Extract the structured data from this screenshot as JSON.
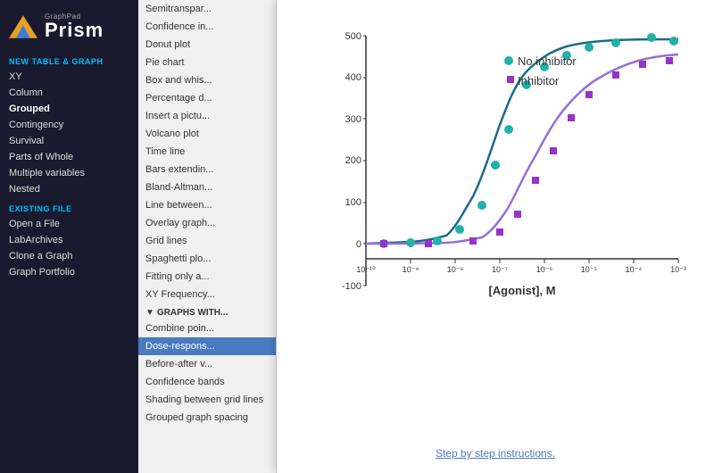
{
  "sidebar": {
    "logo": {
      "graphpad_label": "GraphPad",
      "prism_label": "Prism"
    },
    "new_table_section": "NEW TABLE & GRAPH",
    "items_new": [
      {
        "label": "XY",
        "active": false
      },
      {
        "label": "Column",
        "active": false
      },
      {
        "label": "Grouped",
        "active": true
      },
      {
        "label": "Contingency",
        "active": false
      },
      {
        "label": "Survival",
        "active": false
      },
      {
        "label": "Parts of Whole",
        "active": false
      },
      {
        "label": "Multiple variables",
        "active": false
      },
      {
        "label": "Nested",
        "active": false
      }
    ],
    "existing_file_section": "EXISTING FILE",
    "items_existing": [
      {
        "label": "Open a File",
        "active": false
      },
      {
        "label": "LabArchives",
        "active": false
      },
      {
        "label": "Clone a Graph",
        "active": false
      },
      {
        "label": "Graph Portfolio",
        "active": false
      }
    ]
  },
  "middle_menu": {
    "items_top": [
      {
        "label": "Semitranspar...",
        "selected": false
      },
      {
        "label": "Confidence in...",
        "selected": false
      },
      {
        "label": "Donut plot",
        "selected": false
      },
      {
        "label": "Pie chart",
        "selected": false
      },
      {
        "label": "Box and whis...",
        "selected": false
      },
      {
        "label": "Percentage d...",
        "selected": false
      },
      {
        "label": "Insert a pictu...",
        "selected": false
      },
      {
        "label": "Volcano plot",
        "selected": false
      },
      {
        "label": "Time line",
        "selected": false
      },
      {
        "label": "Bars extendin...",
        "selected": false
      },
      {
        "label": "Bland-Altman...",
        "selected": false
      },
      {
        "label": "Line between...",
        "selected": false
      },
      {
        "label": "Overlay graph...",
        "selected": false
      },
      {
        "label": "Grid lines",
        "selected": false
      },
      {
        "label": "Spaghetti plo...",
        "selected": false
      },
      {
        "label": "Fitting only a...",
        "selected": false
      },
      {
        "label": "XY Frequency...",
        "selected": false
      }
    ],
    "section_graphs_with": "GRAPHS WITH...",
    "items_graphs_with": [
      {
        "label": "Combine poin...",
        "selected": false
      },
      {
        "label": "Dose-respons...",
        "selected": true
      },
      {
        "label": "Before-after v...",
        "selected": false
      },
      {
        "label": "Confidence bands",
        "selected": false
      },
      {
        "label": "Shading between grid lines",
        "selected": false
      },
      {
        "label": "Grouped graph spacing",
        "selected": false
      }
    ]
  },
  "chart": {
    "title": "",
    "x_axis_label": "[Agonist], M",
    "y_axis_max": 500,
    "y_axis_min": -100,
    "legend": [
      {
        "label": "No inhibitor",
        "color": "#008080"
      },
      {
        "label": "Inhibitor",
        "color": "#9932cc"
      }
    ],
    "x_ticks": [
      "10⁻¹⁰",
      "10⁻⁹",
      "10⁻⁸",
      "10⁻⁷",
      "10⁻⁶",
      "10⁻⁵",
      "10⁻⁴",
      "10⁻³"
    ]
  },
  "step_link": "Step by step instructions."
}
